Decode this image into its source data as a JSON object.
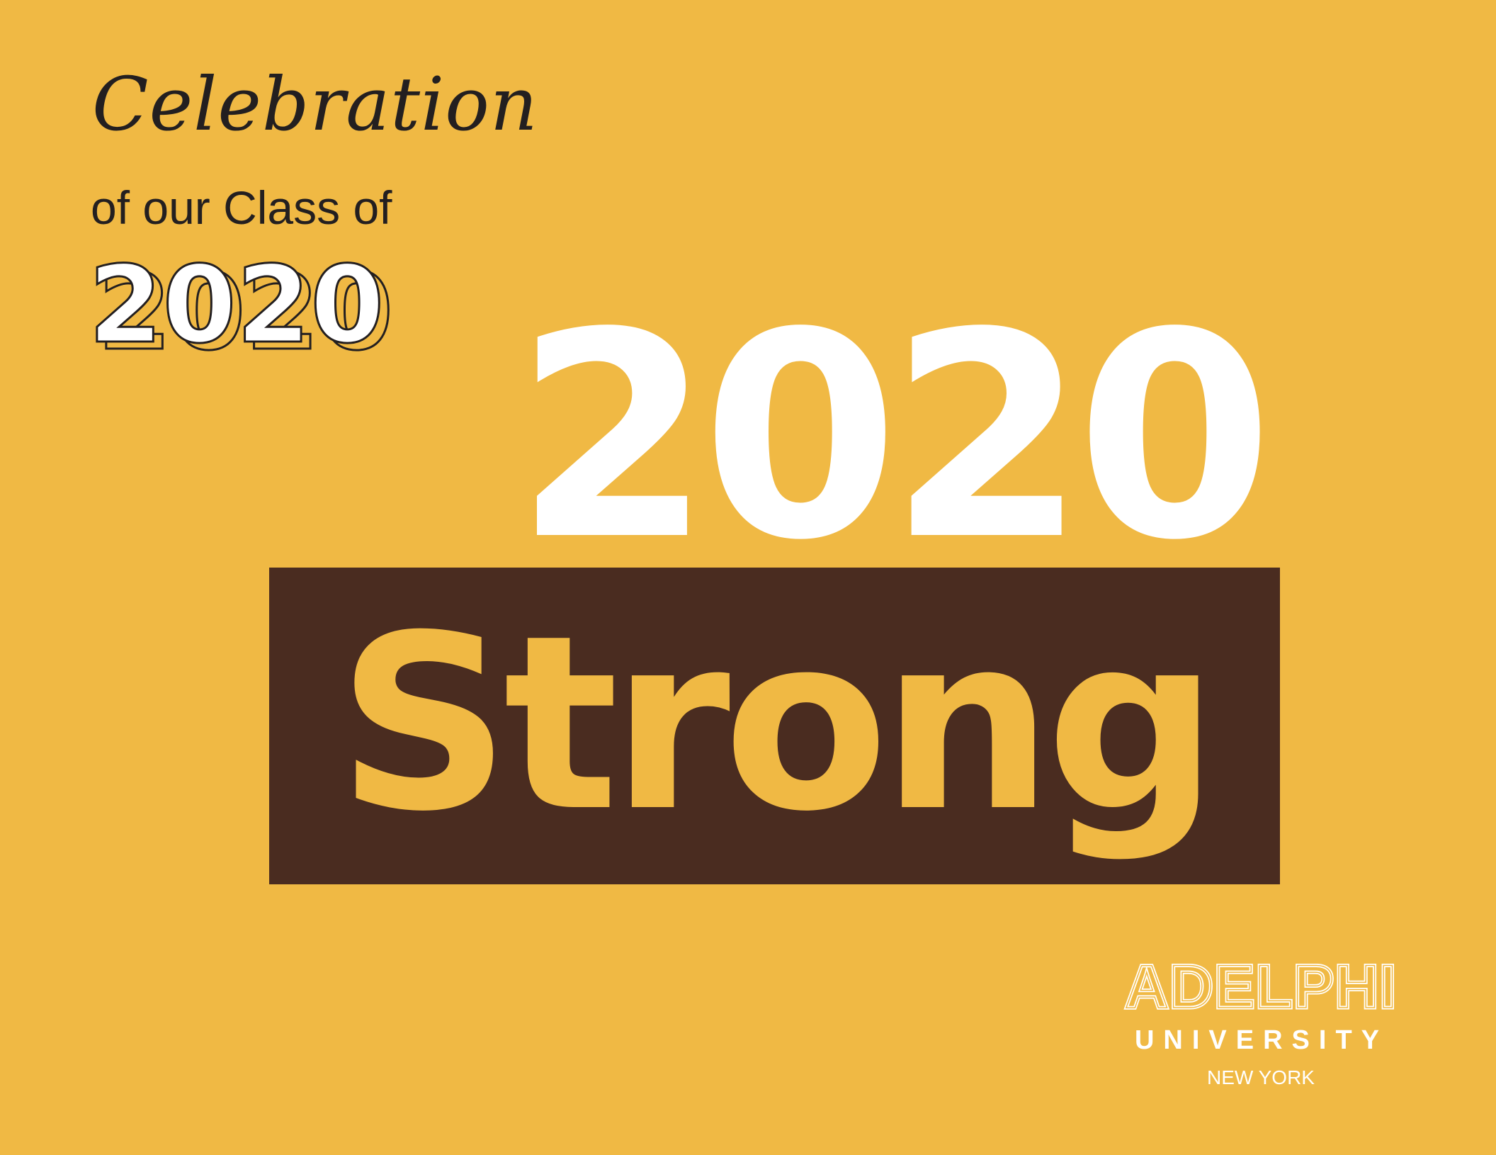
{
  "lockup": {
    "script_text": "Celebration",
    "subline": "of our Class of",
    "year": "2020"
  },
  "headline": {
    "year": "2020",
    "word": "Strong"
  },
  "logo": {
    "wordmark": "ADELPHI",
    "university": "UNIVERSITY",
    "location": "NEW YORK"
  },
  "colors": {
    "background": "#F0B944",
    "box": "#4A2C20",
    "white": "#FFFFFF",
    "ink": "#231F20"
  }
}
